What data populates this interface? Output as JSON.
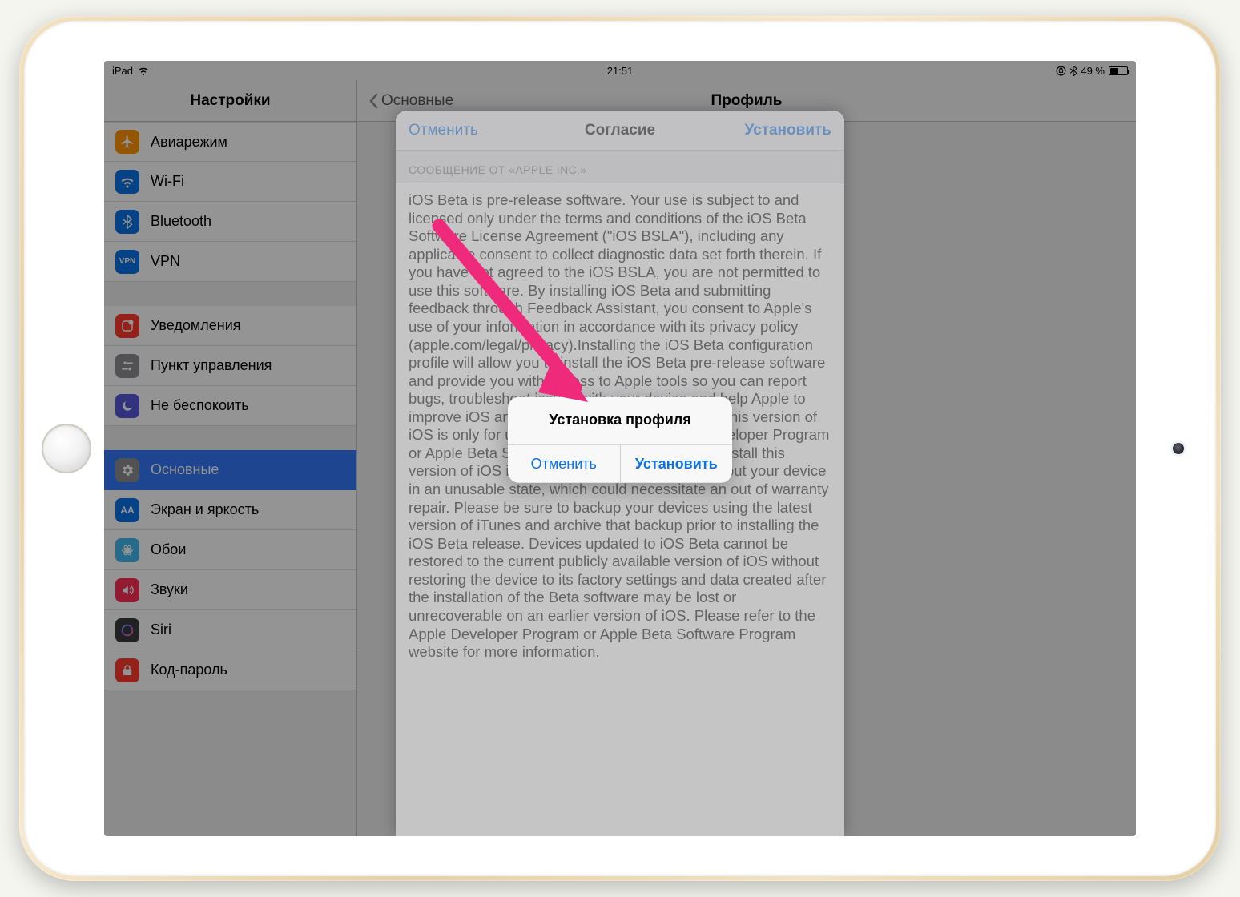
{
  "status": {
    "device": "iPad",
    "time": "21:51",
    "battery_pct": "49 %"
  },
  "sidebar": {
    "title": "Настройки",
    "groups": [
      [
        {
          "label": "Авиарежим",
          "color": "#ff9500"
        },
        {
          "label": "Wi-Fi",
          "color": "#0b72e7"
        },
        {
          "label": "Bluetooth",
          "color": "#0b72e7"
        },
        {
          "label": "VPN",
          "color": "#0b72e7",
          "text": "VPN"
        }
      ],
      [
        {
          "label": "Уведомления",
          "color": "#ff3b30"
        },
        {
          "label": "Пункт управления",
          "color": "#8e8e93"
        },
        {
          "label": "Не беспокоить",
          "color": "#5856d6"
        }
      ],
      [
        {
          "label": "Основные",
          "color": "#8e8e93",
          "selected": true
        },
        {
          "label": "Экран и яркость",
          "color": "#0b72e7",
          "text": "AA"
        },
        {
          "label": "Обои",
          "color": "#45b7ec"
        },
        {
          "label": "Звуки",
          "color": "#ff2d55"
        },
        {
          "label": "Siri",
          "color": "#3c3c3c"
        },
        {
          "label": "Код-пароль",
          "color": "#ff3b30"
        }
      ]
    ]
  },
  "detail": {
    "back": "Основные",
    "title": "Профиль"
  },
  "sheet": {
    "cancel": "Отменить",
    "title": "Согласие",
    "action": "Установить",
    "subheader": "СООБЩЕНИЕ ОТ «APPLE INC.»",
    "body": "iOS Beta is pre-release software.  Your use is subject to and licensed only under the terms and conditions of the iOS Beta Software License Agreement (\"iOS BSLA\"), including any applicable consent to collect diagnostic data set forth therein.  If you have not agreed to the iOS BSLA, you are not permitted to use this software.  By installing iOS Beta and submitting feedback through Feedback Assistant, you consent to Apple's use of your information in accordance with its privacy policy (apple.com/legal/privacy).Installing the iOS Beta configuration profile will allow you to install the iOS Beta pre-release software and provide you with access to Apple tools so you can report bugs, troubleshoot issues with your device and help Apple to improve iOS and related products and services.This version of iOS is only for use by members of the Apple Developer Program or Apple Beta Software Program. Attempting to install this version of iOS in an unauthorized manner could put your device in an unusable state, which could necessitate an out of warranty repair. Please be sure to backup your devices using the latest version of iTunes and archive that backup prior to installing the iOS Beta release.  Devices updated to iOS Beta cannot be restored to the current publicly available version of iOS without restoring the device to its factory settings and data created after the installation of the Beta software may be lost or unrecoverable on an earlier version of iOS.  Please refer to the Apple Developer Program or Apple Beta Software Program website for more information."
  },
  "alert": {
    "title": "Установка профиля",
    "cancel": "Отменить",
    "confirm": "Установить"
  },
  "colors": {
    "ios_blue": "#0b72e7",
    "annotation_pink": "#ef2a7b"
  }
}
